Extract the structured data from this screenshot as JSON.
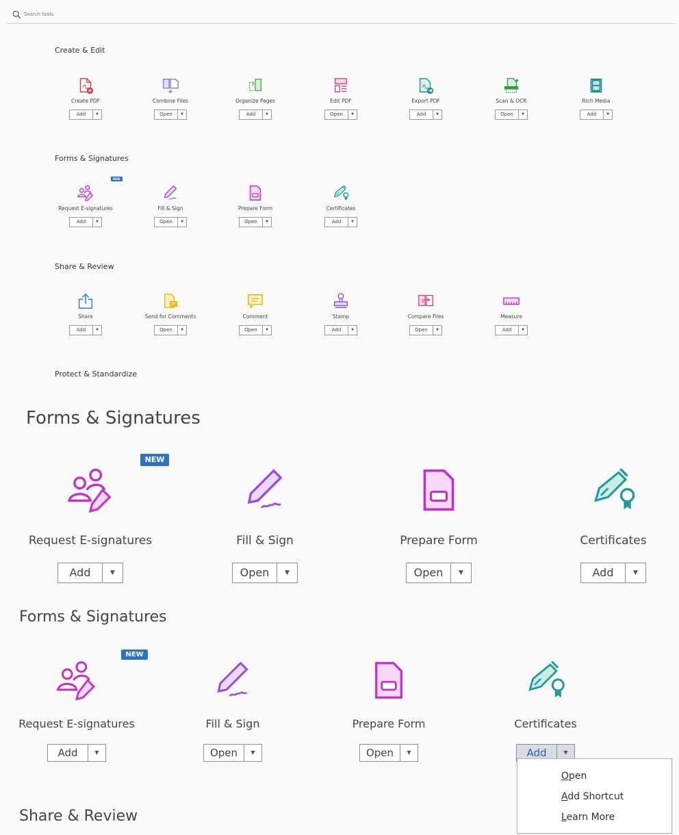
{
  "search": {
    "placeholder": "Search tools"
  },
  "overview": {
    "sections": [
      {
        "title": "Create & Edit",
        "tools": [
          {
            "name": "Create PDF",
            "button": "Add",
            "icon": "create-pdf-icon"
          },
          {
            "name": "Combine Files",
            "button": "Open",
            "icon": "combine-files-icon"
          },
          {
            "name": "Organize Pages",
            "button": "Add",
            "icon": "organize-pages-icon"
          },
          {
            "name": "Edit PDF",
            "button": "Open",
            "icon": "edit-pdf-icon"
          },
          {
            "name": "Export PDF",
            "button": "Add",
            "icon": "export-pdf-icon"
          },
          {
            "name": "Scan & OCR",
            "button": "Open",
            "icon": "scan-ocr-icon"
          },
          {
            "name": "Rich Media",
            "button": "Add",
            "icon": "rich-media-icon"
          }
        ]
      },
      {
        "title": "Forms & Signatures",
        "tools": [
          {
            "name": "Request E-signatures",
            "button": "Add",
            "icon": "request-esignatures-icon",
            "badge": "NEW"
          },
          {
            "name": "Fill & Sign",
            "button": "Open",
            "icon": "fill-sign-icon"
          },
          {
            "name": "Prepare Form",
            "button": "Open",
            "icon": "prepare-form-icon"
          },
          {
            "name": "Certificates",
            "button": "Add",
            "icon": "certificates-icon"
          }
        ]
      },
      {
        "title": "Share & Review",
        "tools": [
          {
            "name": "Share",
            "button": "Add",
            "icon": "share-icon"
          },
          {
            "name": "Send for Comments",
            "button": "Open",
            "icon": "send-for-comments-icon"
          },
          {
            "name": "Comment",
            "button": "Open",
            "icon": "comment-icon"
          },
          {
            "name": "Stamp",
            "button": "Add",
            "icon": "stamp-icon"
          },
          {
            "name": "Compare Files",
            "button": "Open",
            "icon": "compare-files-icon"
          },
          {
            "name": "Measure",
            "button": "Add",
            "icon": "measure-icon"
          }
        ]
      },
      {
        "title": "Protect & Standardize",
        "tools": []
      }
    ]
  },
  "zoom1": {
    "title": "Forms & Signatures",
    "tools": [
      {
        "name": "Request E-signatures",
        "button": "Add",
        "badge": "NEW"
      },
      {
        "name": "Fill & Sign",
        "button": "Open"
      },
      {
        "name": "Prepare Form",
        "button": "Open"
      },
      {
        "name": "Certificates",
        "button": "Add"
      }
    ]
  },
  "zoom2": {
    "title": "Forms & Signatures",
    "tools": [
      {
        "name": "Request E-signatures",
        "button": "Add",
        "badge": "NEW"
      },
      {
        "name": "Fill & Sign",
        "button": "Open"
      },
      {
        "name": "Prepare Form",
        "button": "Open"
      },
      {
        "name": "Certificates",
        "button": "Add"
      }
    ],
    "next_title": "Share & Review"
  },
  "dropdown_menu": {
    "items": [
      {
        "access_key": "O",
        "rest": "pen"
      },
      {
        "access_key": "A",
        "rest": "dd Shortcut"
      },
      {
        "access_key": "L",
        "rest": "earn More"
      }
    ]
  },
  "colors": {
    "accent_blue": "#2d73c4",
    "create_red": "#e0393e",
    "combine_purple": "#7b6fd6",
    "organize_green": "#4aa84a",
    "edit_pink": "#e0397a",
    "export_teal": "#19928a",
    "forms_magenta": "#c52ec9",
    "fill_sign_purple": "#9b4bdc",
    "certificates_teal": "#1f9c98",
    "share_blue": "#2a84d8",
    "comment_yellow": "#e7b600",
    "stamp_purple": "#8a55d3",
    "measure_magenta": "#b431b0"
  }
}
